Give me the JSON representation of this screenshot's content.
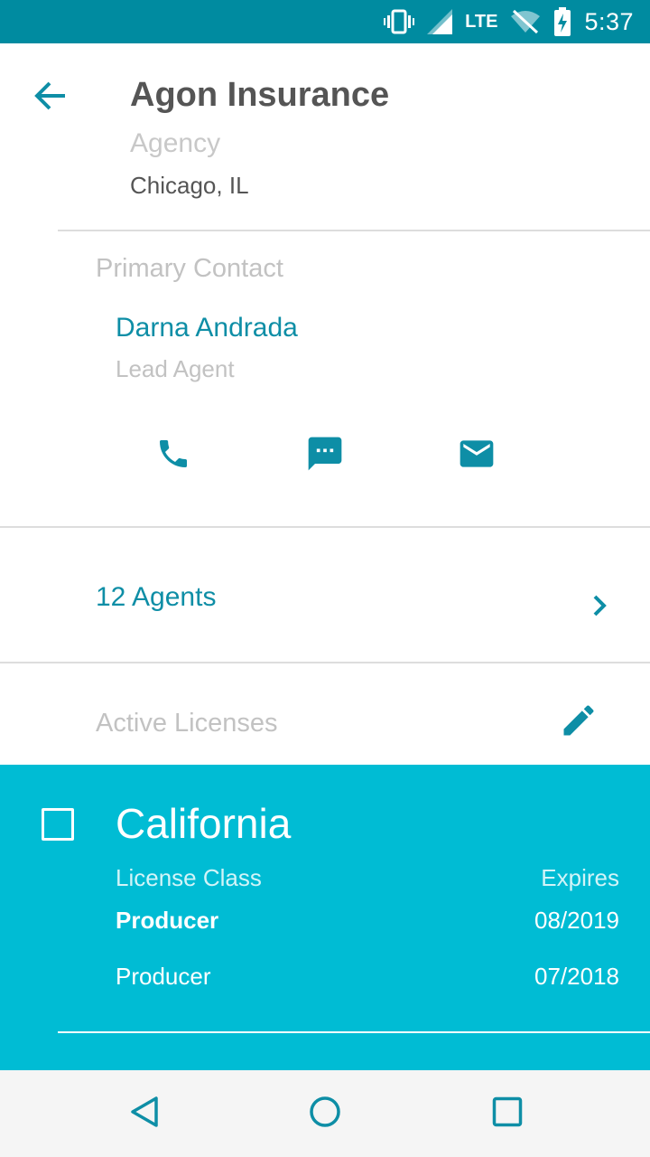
{
  "status_bar": {
    "network": "LTE",
    "time": "5:37",
    "icons": [
      "vibrate-icon",
      "signal-icon",
      "wifi-off-icon",
      "battery-charging-icon"
    ]
  },
  "header": {
    "back_icon": "arrow-back-icon",
    "title": "Agon Insurance",
    "subtitle": "Agency",
    "location": "Chicago, IL"
  },
  "primary_contact": {
    "section_label": "Primary Contact",
    "name": "Darna Andrada",
    "role": "Lead Agent",
    "actions": [
      "phone-icon",
      "message-icon",
      "email-icon"
    ]
  },
  "agents": {
    "label": "12 Agents",
    "chevron_icon": "chevron-right-icon"
  },
  "licenses": {
    "section_label": "Active Licenses",
    "edit_icon": "pencil-icon",
    "card": {
      "state": "California",
      "class_header": "License Class",
      "expires_header": "Expires",
      "rows": [
        {
          "class": "Producer",
          "expires": "08/2019"
        },
        {
          "class": "Producer",
          "expires": "07/2018"
        }
      ]
    }
  },
  "nav_bar": {
    "icons": [
      "back-triangle-icon",
      "home-circle-icon",
      "recents-square-icon"
    ]
  },
  "colors": {
    "status_bar": "#008ba0",
    "accent": "#0e8ea6",
    "card": "#00bcd4",
    "nav_icon": "#0e8ea6"
  }
}
